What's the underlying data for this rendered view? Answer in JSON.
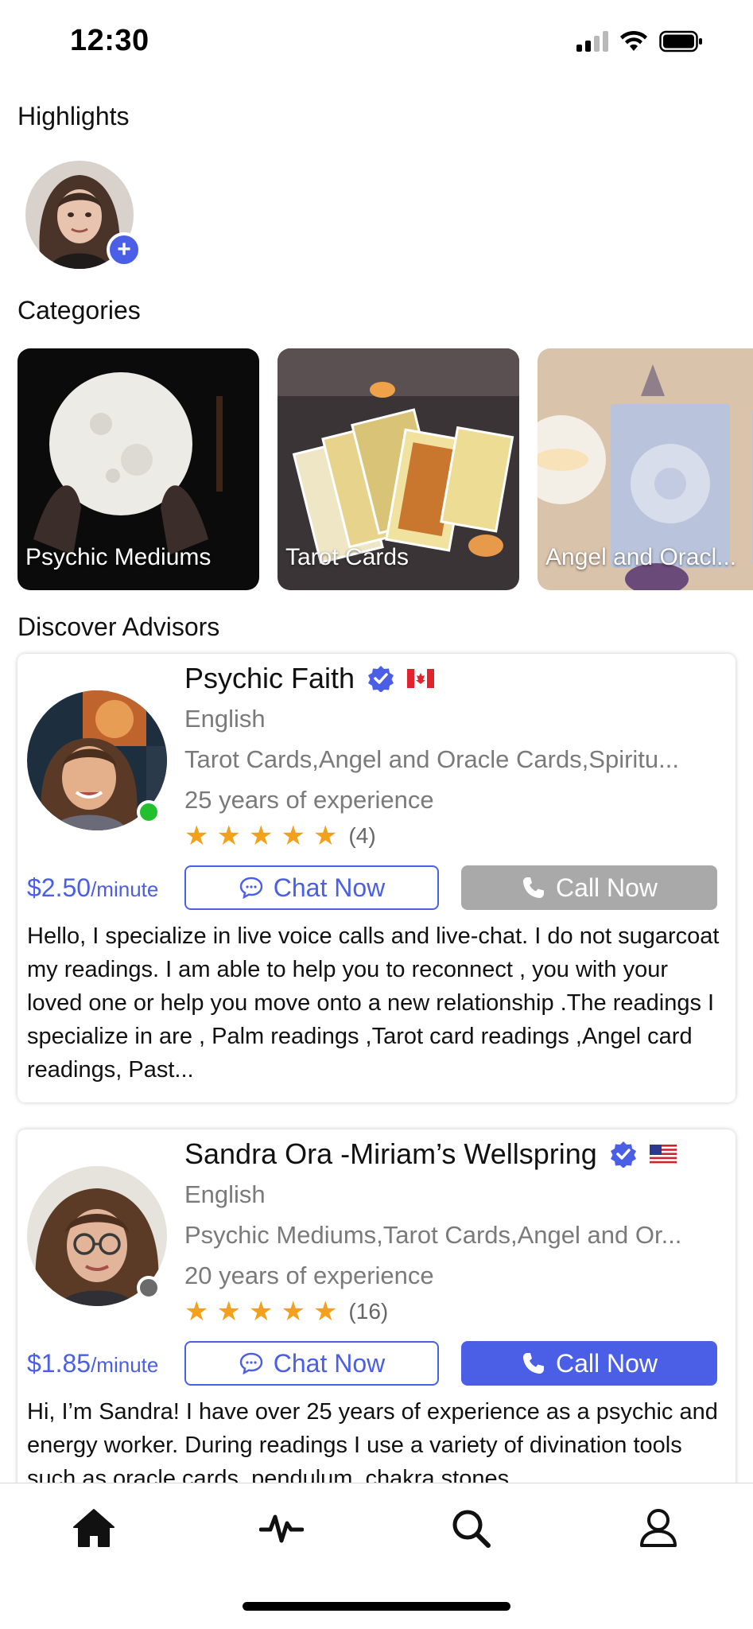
{
  "status_bar": {
    "time": "12:30"
  },
  "highlights": {
    "title": "Highlights",
    "add_symbol": "+"
  },
  "categories": {
    "title": "Categories",
    "items": [
      {
        "label": "Psychic Mediums"
      },
      {
        "label": "Tarot Cards"
      },
      {
        "label": "Angel and Oracl..."
      }
    ]
  },
  "discover": {
    "title": "Discover Advisors",
    "advisors": [
      {
        "name": "Psychic Faith",
        "language": "English",
        "specialties": "Tarot Cards,Angel and Oracle Cards,Spiritu...",
        "experience": "25 years of experience",
        "rating_stars": 5,
        "review_count": "(4)",
        "price": "$2.50",
        "price_unit": "/minute",
        "chat_label": "Chat Now",
        "call_label": "Call Now",
        "call_color": "#a9a9a9",
        "online": true,
        "presence_color": "#22c02e",
        "country_flag": "Canada",
        "bio": "Hello, I specialize in live voice calls and live-chat. I do not sugarcoat my readings. I am able to help you to reconnect , you with your loved one or help you move onto a new relationship .The readings I specialize in are  , Palm readings ,Tarot card readings ,Angel card readings, Past..."
      },
      {
        "name": "Sandra Ora -Miriam’s Wellspring",
        "language": "English",
        "specialties": "Psychic Mediums,Tarot Cards,Angel and Or...",
        "experience": "20 years of experience",
        "rating_stars": 5,
        "review_count": "(16)",
        "price": "$1.85",
        "price_unit": "/minute",
        "chat_label": "Chat Now",
        "call_label": "Call Now",
        "call_color": "#4a5fe6",
        "online": false,
        "presence_color": "#6b6b6b",
        "country_flag": "United States",
        "bio": "Hi, I’m Sandra! I have over 25 years of experience as a psychic and energy worker. During readings I use a variety of divination tools such as oracle cards, pendulum, chakra stones"
      }
    ]
  },
  "bottom_nav": {
    "items": [
      {
        "icon": "home-icon"
      },
      {
        "icon": "activity-pulse-icon"
      },
      {
        "icon": "search-icon"
      },
      {
        "icon": "profile-icon"
      }
    ]
  },
  "colors": {
    "accent": "#4a5fe6",
    "star": "#f2a11a"
  }
}
